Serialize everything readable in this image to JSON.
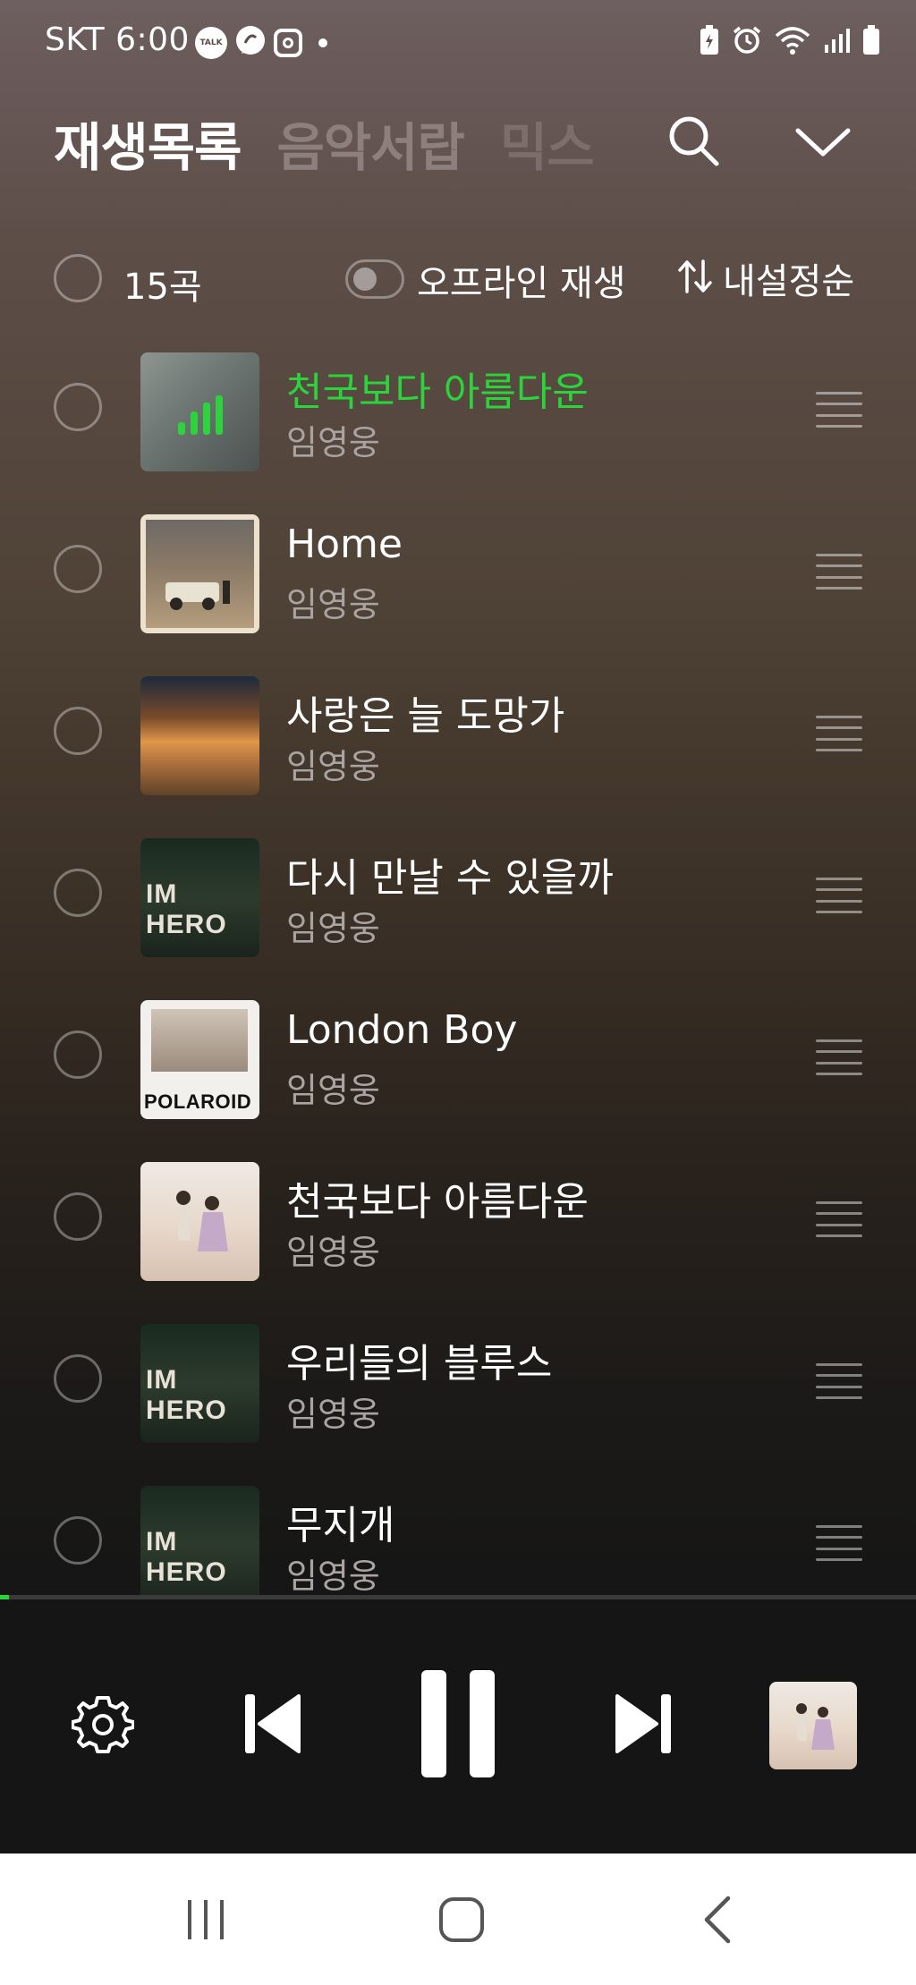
{
  "status_bar": {
    "carrier_time": "SKT 6:00",
    "icons_left": [
      "kakaotalk-icon",
      "chat-bubble-icon",
      "instagram-icon",
      "notification-dot-icon"
    ],
    "icons_right": [
      "battery-saver-icon",
      "alarm-icon",
      "wifi-icon",
      "signal-icon",
      "battery-icon"
    ],
    "talk_badge": "TALK"
  },
  "header": {
    "tabs": [
      {
        "label": "재생목록",
        "active": true
      },
      {
        "label": "음악서랍",
        "active": false
      },
      {
        "label": "믹스",
        "active": false
      }
    ],
    "search_icon": "search-icon",
    "collapse_icon": "chevron-down-icon"
  },
  "toolbar": {
    "count_label": "15곡",
    "offline_label": "오프라인 재생",
    "offline_enabled": false,
    "sort_label": "내설정순"
  },
  "tracks": [
    {
      "title": "천국보다 아름다운",
      "artist": "임영웅",
      "playing": true
    },
    {
      "title": "Home",
      "artist": "임영웅",
      "playing": false
    },
    {
      "title": "사랑은 늘 도망가",
      "artist": "임영웅",
      "playing": false
    },
    {
      "title": "다시 만날 수 있을까",
      "artist": "임영웅",
      "playing": false
    },
    {
      "title": "London Boy",
      "artist": "임영웅",
      "playing": false
    },
    {
      "title": "천국보다 아름다운",
      "artist": "임영웅",
      "playing": false
    },
    {
      "title": "우리들의 블루스",
      "artist": "임영웅",
      "playing": false
    },
    {
      "title": "무지개",
      "artist": "임영웅",
      "playing": false
    }
  ],
  "album_art_text": {
    "im_hero": "IM HERO",
    "polaroid": "POLAROID"
  },
  "player": {
    "progress_fraction": 0.01,
    "controls": [
      "gear-icon",
      "skip-previous-icon",
      "pause-icon",
      "skip-next-icon"
    ]
  },
  "colors": {
    "accent_green": "#2bd43b",
    "inactive_tab": "#8c7f7c",
    "artist_gray": "#a9a3a1"
  },
  "nav_bar": {
    "buttons": [
      "recent-apps-icon",
      "home-icon",
      "back-icon"
    ]
  }
}
